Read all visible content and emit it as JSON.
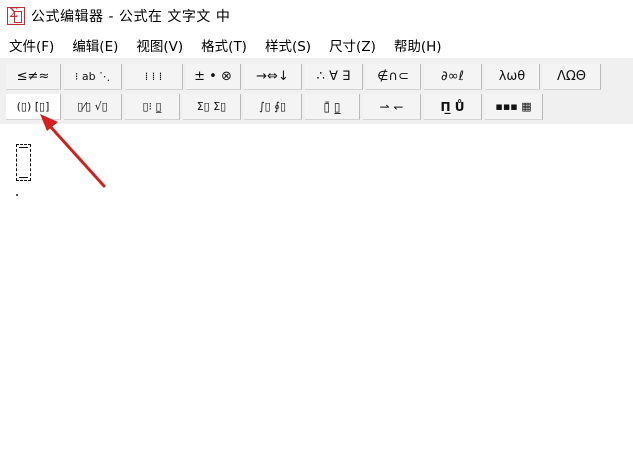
{
  "window": {
    "title": "公式编辑器 - 公式在 文字文 中"
  },
  "menu": [
    {
      "label": "文件(F)",
      "id": "file"
    },
    {
      "label": "编辑(E)",
      "id": "edit"
    },
    {
      "label": "视图(V)",
      "id": "view"
    },
    {
      "label": "格式(T)",
      "id": "format"
    },
    {
      "label": "样式(S)",
      "id": "style"
    },
    {
      "label": "尺寸(Z)",
      "id": "size"
    },
    {
      "label": "帮助(H)",
      "id": "help"
    }
  ],
  "toolbar": {
    "row1": [
      {
        "name": "relations-palette-button",
        "icon": "less-equal-not-equal-approx-icon",
        "glyph": "≤≠≈"
      },
      {
        "name": "spaces-ellipses-palette-button",
        "icon": "spacing-ellipsis-icon",
        "glyph": "⁝ ab ⋱"
      },
      {
        "name": "embellishments-palette-button",
        "icon": "embellishment-icon",
        "glyph": "⁞ ⁞ ⁞"
      },
      {
        "name": "operators-palette-button",
        "icon": "plus-minus-bullet-otimes-icon",
        "glyph": "± • ⊗"
      },
      {
        "name": "arrows-palette-button",
        "icon": "arrow-icon",
        "glyph": "→⇔↓"
      },
      {
        "name": "logical-palette-button",
        "icon": "therefore-forall-exists-icon",
        "glyph": "∴ ∀ ∃"
      },
      {
        "name": "set-theory-palette-button",
        "icon": "not-in-intersection-subset-icon",
        "glyph": "∉∩⊂"
      },
      {
        "name": "misc-symbols-palette-button",
        "icon": "partial-infinity-ell-icon",
        "glyph": "∂∞ℓ"
      },
      {
        "name": "greek-lowercase-palette-button",
        "icon": "lambda-omega-theta-icon",
        "glyph": "λωθ"
      },
      {
        "name": "greek-uppercase-palette-button",
        "icon": "lambda-omega-theta-upper-icon",
        "glyph": "ΛΩΘ"
      }
    ],
    "row2": [
      {
        "name": "fence-templates-button",
        "icon": "parentheses-brackets-template-icon",
        "glyph": "(▯) [▯]"
      },
      {
        "name": "fraction-radical-templates-button",
        "icon": "fraction-sqrt-template-icon",
        "glyph": "▯⁄▯ √▯"
      },
      {
        "name": "script-templates-button",
        "icon": "sub-superscript-template-icon",
        "glyph": "▯⁝ ▯̲"
      },
      {
        "name": "summation-templates-button",
        "icon": "summation-template-icon",
        "glyph": "Σ▯ Σ▯"
      },
      {
        "name": "integral-templates-button",
        "icon": "integral-template-icon",
        "glyph": "∫▯ ∮▯"
      },
      {
        "name": "underbar-overbar-templates-button",
        "icon": "overbar-underbar-template-icon",
        "glyph": "▯̄ ▯̲"
      },
      {
        "name": "labeled-arrow-templates-button",
        "icon": "labeled-arrow-template-icon",
        "glyph": "⇀ ↽"
      },
      {
        "name": "products-set-templates-button",
        "icon": "product-union-template-icon",
        "glyph": "Π̲ Ů"
      },
      {
        "name": "matrix-templates-button",
        "icon": "matrix-template-icon",
        "glyph": "▪▪▪ ▦"
      }
    ]
  },
  "accent_color": "#d32020"
}
